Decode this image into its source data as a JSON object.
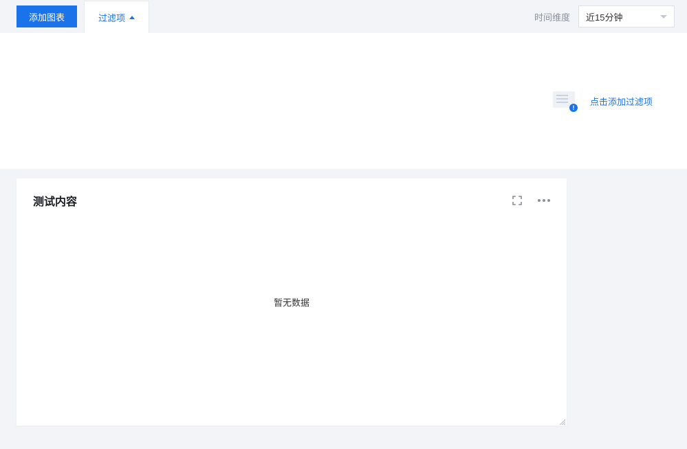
{
  "toolbar": {
    "add_chart_label": "添加图表",
    "filter_tab_label": "过滤项",
    "time_dimension_label": "时间维度",
    "time_select_value": "近15分钟"
  },
  "filter_panel": {
    "add_filter_link": "点击添加过滤项",
    "icon_name": "document-info-icon"
  },
  "card": {
    "title": "测试内容",
    "empty_text": "暂无数据"
  }
}
